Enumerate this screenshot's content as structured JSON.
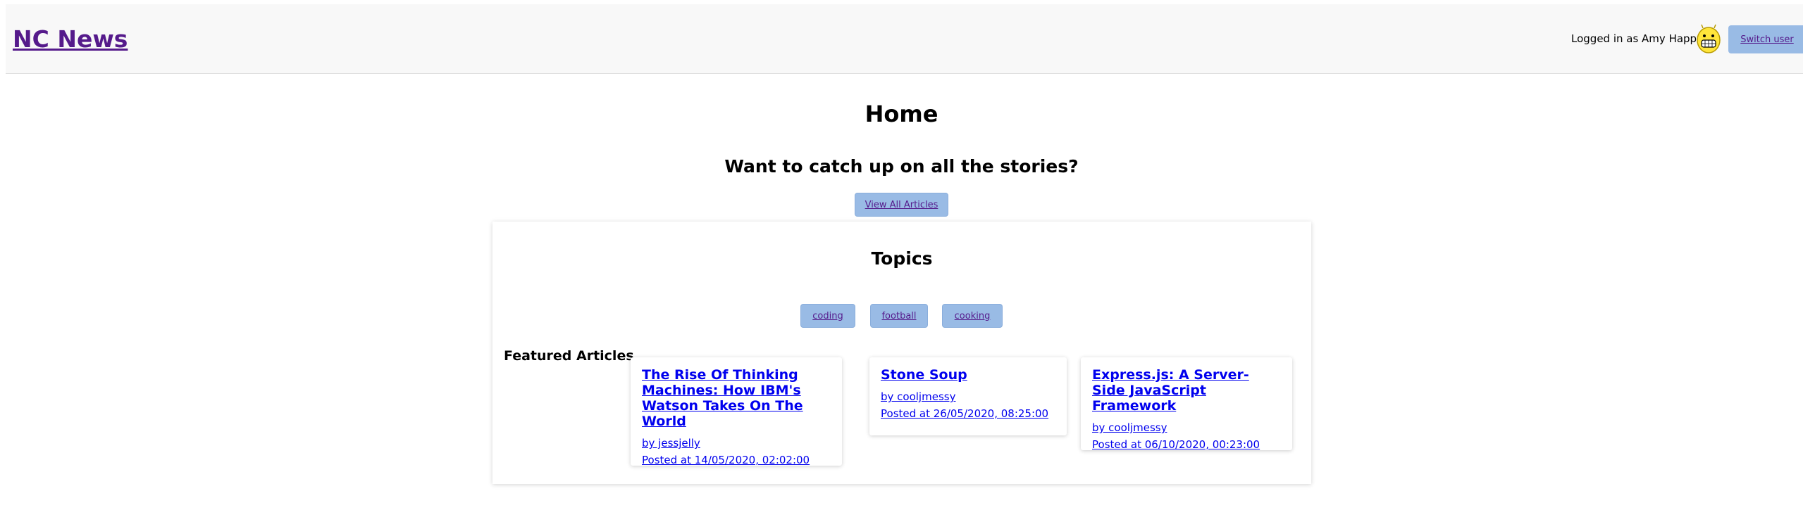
{
  "header": {
    "site_title": "NC News",
    "login_text": "Logged in as Amy Happy",
    "switch_user_label": "Switch user",
    "avatar_icon": "smiley-avatar-icon"
  },
  "main": {
    "page_title": "Home",
    "catchup_text": "Want to catch up on all the stories?",
    "view_all_label": "View All Articles",
    "topics_title": "Topics",
    "topics": [
      {
        "label": "coding"
      },
      {
        "label": "football"
      },
      {
        "label": "cooking"
      }
    ],
    "featured_label": "Featured Articles",
    "articles": [
      {
        "title": "The Rise Of Thinking Machines: How IBM's Watson Takes On The World",
        "author": "by jessjelly",
        "posted": "Posted at 14/05/2020, 02:02:00"
      },
      {
        "title": "Stone Soup",
        "author": "by cooljmessy",
        "posted": "Posted at 26/05/2020, 08:25:00"
      },
      {
        "title": "Express.js: A Server-Side JavaScript Framework",
        "author": "by cooljmessy",
        "posted": "Posted at 06/10/2020, 00:23:00"
      }
    ]
  },
  "colors": {
    "header_bg": "#f8f8f8",
    "button_bg": "#99bbe5",
    "visited_link": "#551a8b",
    "link": "#0000ee"
  }
}
